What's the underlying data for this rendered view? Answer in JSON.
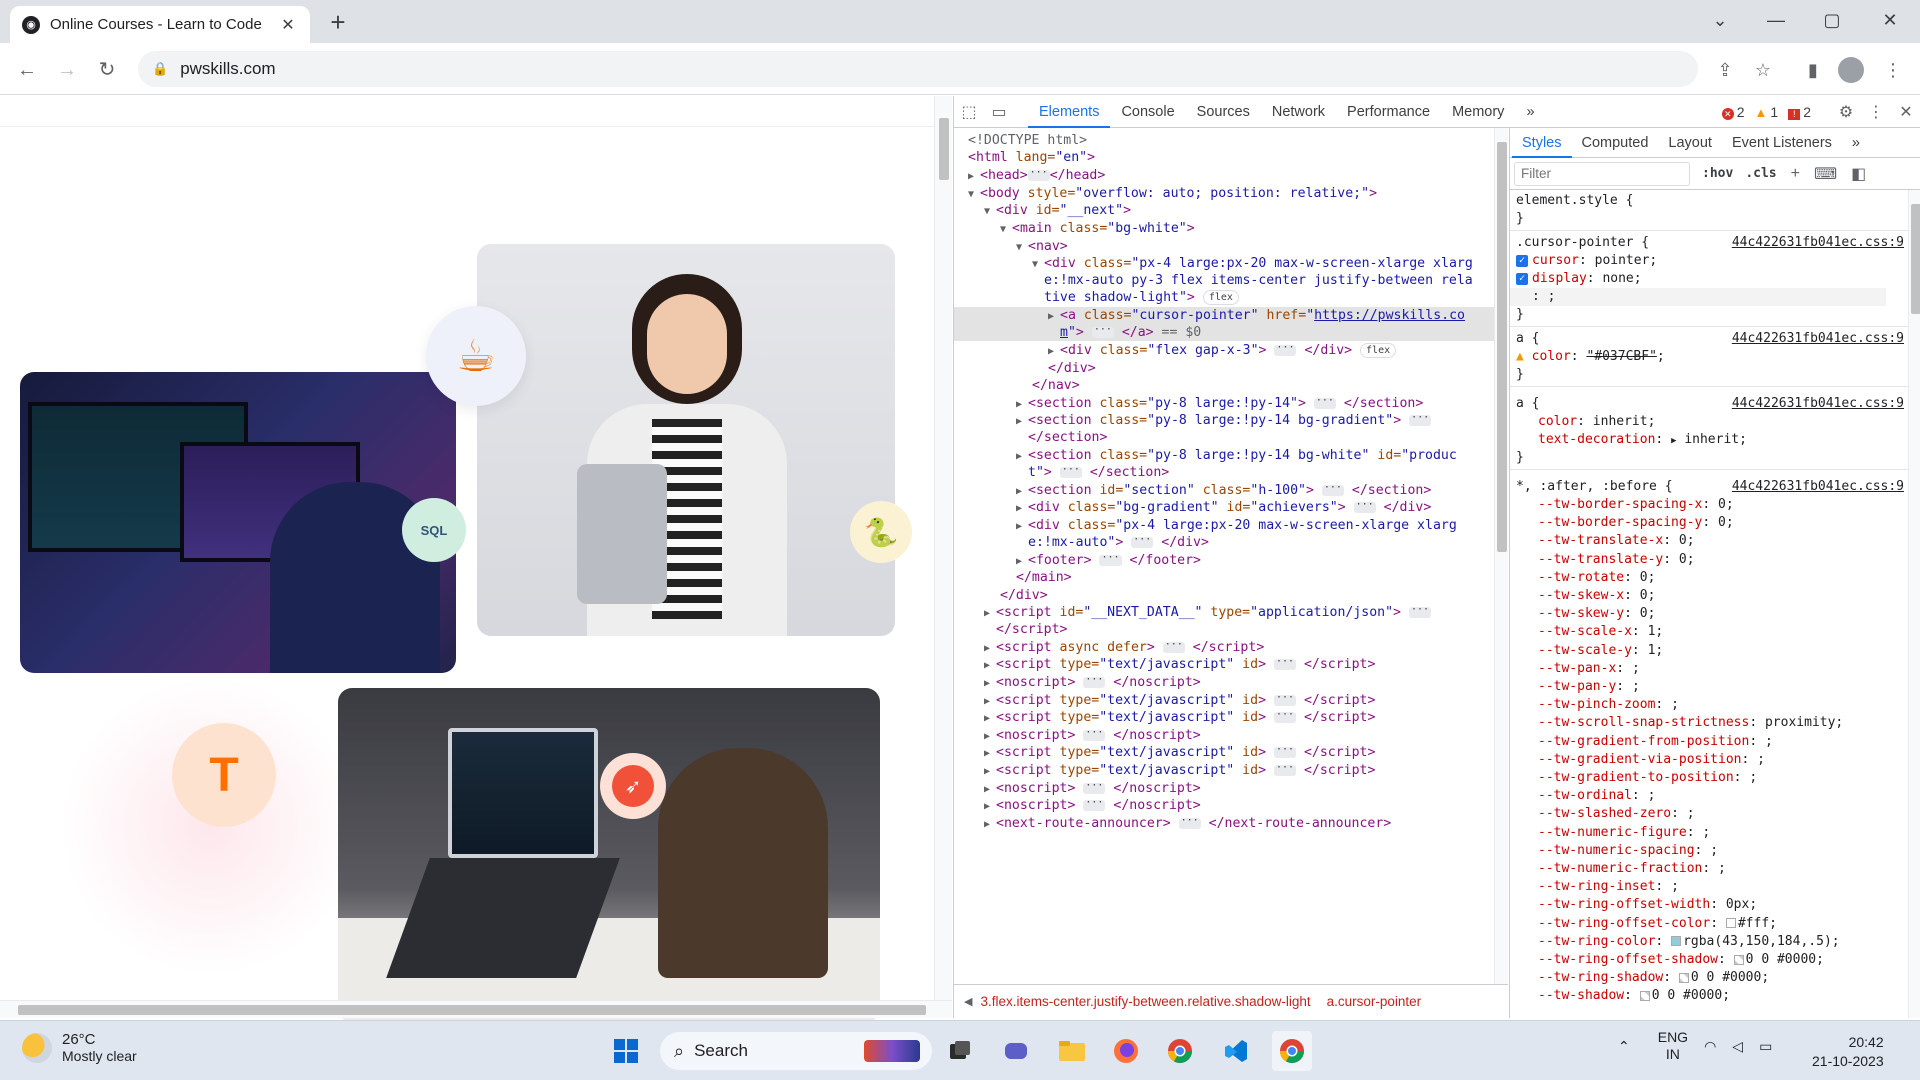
{
  "browser": {
    "tab_title": "Online Courses - Learn to Code",
    "tab_close": "✕",
    "new_tab": "+",
    "url": "pwskills.com",
    "window": {
      "minimize": "—",
      "maximize": "▢",
      "close": "✕",
      "tabsearch": "⌄"
    }
  },
  "page": {
    "badges": {
      "java": "☕",
      "sql": "SQL",
      "python": "🐍",
      "tensorflow": "T",
      "swift": "➶"
    }
  },
  "devtools": {
    "tabs": [
      "Elements",
      "Console",
      "Sources",
      "Network",
      "Performance",
      "Memory"
    ],
    "more_tabs": "»",
    "issues": {
      "errors": "2",
      "warnings": "1",
      "blocked": "2"
    },
    "dom": {
      "doctype": "<!DOCTYPE html>",
      "html_open": "<html",
      "html_attr": " lang=",
      "html_val": "\"en\"",
      "body_style": "\"overflow: auto; position: relative;\"",
      "next_id": "\"__next\"",
      "main_class": "\"bg-white\"",
      "nav_div_class_1": "\"px-4 large:px-20 max-w-screen-xlarge xlarg",
      "nav_div_class_2": "e:!mx-auto py-3 flex items-center justify-between rela",
      "nav_div_class_3": "tive shadow-light\"",
      "flex_pill": "flex",
      "a_class": "\"cursor-pointer\"",
      "a_href_1": "https://pwskills.co",
      "a_href_2": "m",
      "a_eq": "== $0",
      "gap_div_class": "\"flex gap-x-3\"",
      "section1": "\"py-8 large:!py-14\"",
      "section2": "\"py-8 large:!py-14 bg-gradient\"",
      "section3": "\"py-8 large:!py-14 bg-white\"",
      "section3_id_1": "\"produc",
      "section3_id_2": "t\"",
      "section4_id": "\"section\"",
      "section4_class": "\"h-100\"",
      "achievers_class": "\"bg-gradient\"",
      "achievers_id": "\"achievers\"",
      "container_class_1": "\"px-4 large:px-20 max-w-screen-xlarge xlarg",
      "container_class_2": "e:!mx-auto\"",
      "next_data_id": "\"__NEXT_DATA__\"",
      "json_type": "\"application/json\"",
      "js_type": "\"text/javascript\""
    },
    "breadcrumbs": [
      "3.flex.items-center.justify-between.relative.shadow-light",
      "a.cursor-pointer"
    ],
    "styles": {
      "tabs": [
        "Styles",
        "Computed",
        "Layout",
        "Event Listeners"
      ],
      "filter_placeholder": "Filter",
      "hov": ":hov",
      "cls": ".cls",
      "source": "44c422631fb041ec.css:9",
      "tw_vars": [
        [
          "--tw-border-spacing-x",
          "0;"
        ],
        [
          "--tw-border-spacing-y",
          "0;"
        ],
        [
          "--tw-translate-x",
          "0;"
        ],
        [
          "--tw-translate-y",
          "0;"
        ],
        [
          "--tw-rotate",
          "0;"
        ],
        [
          "--tw-skew-x",
          "0;"
        ],
        [
          "--tw-skew-y",
          "0;"
        ],
        [
          "--tw-scale-x",
          "1;"
        ],
        [
          "--tw-scale-y",
          "1;"
        ],
        [
          "--tw-pan-x",
          ";"
        ],
        [
          "--tw-pan-y",
          ";"
        ],
        [
          "--tw-pinch-zoom",
          ";"
        ],
        [
          "--tw-scroll-snap-strictness",
          "proximity;"
        ],
        [
          "--tw-gradient-from-position",
          ";"
        ],
        [
          "--tw-gradient-via-position",
          ";"
        ],
        [
          "--tw-gradient-to-position",
          ";"
        ],
        [
          "--tw-ordinal",
          ";"
        ],
        [
          "--tw-slashed-zero",
          ";"
        ],
        [
          "--tw-numeric-figure",
          ";"
        ],
        [
          "--tw-numeric-spacing",
          ";"
        ],
        [
          "--tw-numeric-fraction",
          ";"
        ],
        [
          "--tw-ring-inset",
          ";"
        ],
        [
          "--tw-ring-offset-width",
          "0px;"
        ],
        [
          "--tw-ring-offset-color",
          "#fff;"
        ],
        [
          "--tw-ring-color",
          "rgba(43,150,184,.5);"
        ],
        [
          "--tw-ring-offset-shadow",
          "0 0 #0000;"
        ],
        [
          "--tw-ring-shadow",
          "0 0 #0000;"
        ],
        [
          "--tw-shadow",
          "0 0 #0000;"
        ]
      ]
    }
  },
  "taskbar": {
    "weather_temp": "26°C",
    "weather_desc": "Mostly clear",
    "search_label": "Search",
    "lang": "ENG",
    "region": "IN",
    "time": "20:42",
    "date": "21-10-2023"
  }
}
